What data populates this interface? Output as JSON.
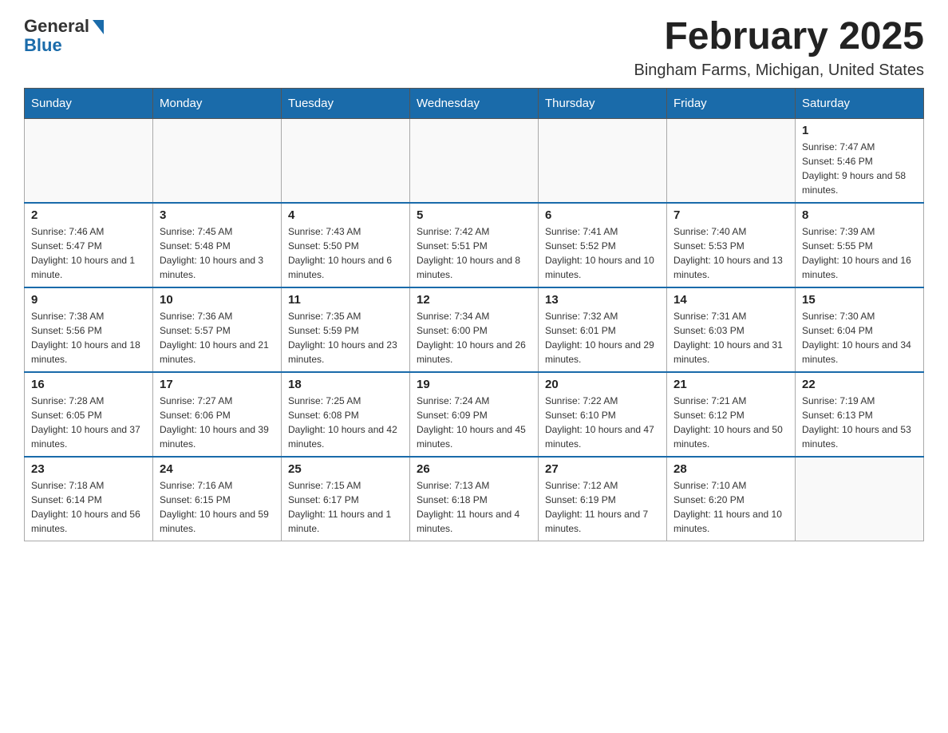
{
  "header": {
    "logo_general": "General",
    "logo_blue": "Blue",
    "month_title": "February 2025",
    "location": "Bingham Farms, Michigan, United States"
  },
  "days_of_week": [
    "Sunday",
    "Monday",
    "Tuesday",
    "Wednesday",
    "Thursday",
    "Friday",
    "Saturday"
  ],
  "weeks": [
    [
      {
        "day": "",
        "sunrise": "",
        "sunset": "",
        "daylight": ""
      },
      {
        "day": "",
        "sunrise": "",
        "sunset": "",
        "daylight": ""
      },
      {
        "day": "",
        "sunrise": "",
        "sunset": "",
        "daylight": ""
      },
      {
        "day": "",
        "sunrise": "",
        "sunset": "",
        "daylight": ""
      },
      {
        "day": "",
        "sunrise": "",
        "sunset": "",
        "daylight": ""
      },
      {
        "day": "",
        "sunrise": "",
        "sunset": "",
        "daylight": ""
      },
      {
        "day": "1",
        "sunrise": "Sunrise: 7:47 AM",
        "sunset": "Sunset: 5:46 PM",
        "daylight": "Daylight: 9 hours and 58 minutes."
      }
    ],
    [
      {
        "day": "2",
        "sunrise": "Sunrise: 7:46 AM",
        "sunset": "Sunset: 5:47 PM",
        "daylight": "Daylight: 10 hours and 1 minute."
      },
      {
        "day": "3",
        "sunrise": "Sunrise: 7:45 AM",
        "sunset": "Sunset: 5:48 PM",
        "daylight": "Daylight: 10 hours and 3 minutes."
      },
      {
        "day": "4",
        "sunrise": "Sunrise: 7:43 AM",
        "sunset": "Sunset: 5:50 PM",
        "daylight": "Daylight: 10 hours and 6 minutes."
      },
      {
        "day": "5",
        "sunrise": "Sunrise: 7:42 AM",
        "sunset": "Sunset: 5:51 PM",
        "daylight": "Daylight: 10 hours and 8 minutes."
      },
      {
        "day": "6",
        "sunrise": "Sunrise: 7:41 AM",
        "sunset": "Sunset: 5:52 PM",
        "daylight": "Daylight: 10 hours and 10 minutes."
      },
      {
        "day": "7",
        "sunrise": "Sunrise: 7:40 AM",
        "sunset": "Sunset: 5:53 PM",
        "daylight": "Daylight: 10 hours and 13 minutes."
      },
      {
        "day": "8",
        "sunrise": "Sunrise: 7:39 AM",
        "sunset": "Sunset: 5:55 PM",
        "daylight": "Daylight: 10 hours and 16 minutes."
      }
    ],
    [
      {
        "day": "9",
        "sunrise": "Sunrise: 7:38 AM",
        "sunset": "Sunset: 5:56 PM",
        "daylight": "Daylight: 10 hours and 18 minutes."
      },
      {
        "day": "10",
        "sunrise": "Sunrise: 7:36 AM",
        "sunset": "Sunset: 5:57 PM",
        "daylight": "Daylight: 10 hours and 21 minutes."
      },
      {
        "day": "11",
        "sunrise": "Sunrise: 7:35 AM",
        "sunset": "Sunset: 5:59 PM",
        "daylight": "Daylight: 10 hours and 23 minutes."
      },
      {
        "day": "12",
        "sunrise": "Sunrise: 7:34 AM",
        "sunset": "Sunset: 6:00 PM",
        "daylight": "Daylight: 10 hours and 26 minutes."
      },
      {
        "day": "13",
        "sunrise": "Sunrise: 7:32 AM",
        "sunset": "Sunset: 6:01 PM",
        "daylight": "Daylight: 10 hours and 29 minutes."
      },
      {
        "day": "14",
        "sunrise": "Sunrise: 7:31 AM",
        "sunset": "Sunset: 6:03 PM",
        "daylight": "Daylight: 10 hours and 31 minutes."
      },
      {
        "day": "15",
        "sunrise": "Sunrise: 7:30 AM",
        "sunset": "Sunset: 6:04 PM",
        "daylight": "Daylight: 10 hours and 34 minutes."
      }
    ],
    [
      {
        "day": "16",
        "sunrise": "Sunrise: 7:28 AM",
        "sunset": "Sunset: 6:05 PM",
        "daylight": "Daylight: 10 hours and 37 minutes."
      },
      {
        "day": "17",
        "sunrise": "Sunrise: 7:27 AM",
        "sunset": "Sunset: 6:06 PM",
        "daylight": "Daylight: 10 hours and 39 minutes."
      },
      {
        "day": "18",
        "sunrise": "Sunrise: 7:25 AM",
        "sunset": "Sunset: 6:08 PM",
        "daylight": "Daylight: 10 hours and 42 minutes."
      },
      {
        "day": "19",
        "sunrise": "Sunrise: 7:24 AM",
        "sunset": "Sunset: 6:09 PM",
        "daylight": "Daylight: 10 hours and 45 minutes."
      },
      {
        "day": "20",
        "sunrise": "Sunrise: 7:22 AM",
        "sunset": "Sunset: 6:10 PM",
        "daylight": "Daylight: 10 hours and 47 minutes."
      },
      {
        "day": "21",
        "sunrise": "Sunrise: 7:21 AM",
        "sunset": "Sunset: 6:12 PM",
        "daylight": "Daylight: 10 hours and 50 minutes."
      },
      {
        "day": "22",
        "sunrise": "Sunrise: 7:19 AM",
        "sunset": "Sunset: 6:13 PM",
        "daylight": "Daylight: 10 hours and 53 minutes."
      }
    ],
    [
      {
        "day": "23",
        "sunrise": "Sunrise: 7:18 AM",
        "sunset": "Sunset: 6:14 PM",
        "daylight": "Daylight: 10 hours and 56 minutes."
      },
      {
        "day": "24",
        "sunrise": "Sunrise: 7:16 AM",
        "sunset": "Sunset: 6:15 PM",
        "daylight": "Daylight: 10 hours and 59 minutes."
      },
      {
        "day": "25",
        "sunrise": "Sunrise: 7:15 AM",
        "sunset": "Sunset: 6:17 PM",
        "daylight": "Daylight: 11 hours and 1 minute."
      },
      {
        "day": "26",
        "sunrise": "Sunrise: 7:13 AM",
        "sunset": "Sunset: 6:18 PM",
        "daylight": "Daylight: 11 hours and 4 minutes."
      },
      {
        "day": "27",
        "sunrise": "Sunrise: 7:12 AM",
        "sunset": "Sunset: 6:19 PM",
        "daylight": "Daylight: 11 hours and 7 minutes."
      },
      {
        "day": "28",
        "sunrise": "Sunrise: 7:10 AM",
        "sunset": "Sunset: 6:20 PM",
        "daylight": "Daylight: 11 hours and 10 minutes."
      },
      {
        "day": "",
        "sunrise": "",
        "sunset": "",
        "daylight": ""
      }
    ]
  ]
}
